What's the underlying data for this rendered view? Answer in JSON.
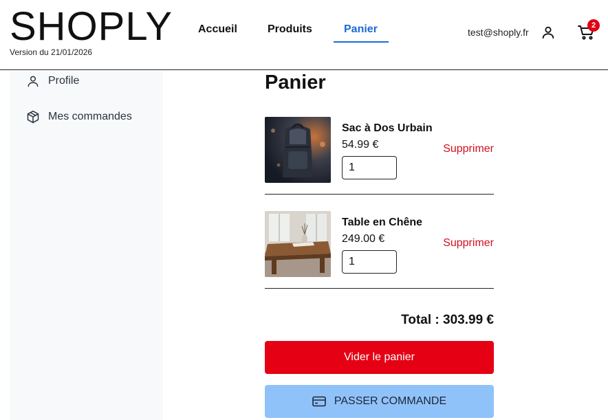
{
  "brand": {
    "logo": "SHOPLY",
    "version": "Version du 21/01/2026"
  },
  "nav": {
    "items": [
      {
        "label": "Accueil"
      },
      {
        "label": "Produits"
      },
      {
        "label": "Panier",
        "active": true
      }
    ]
  },
  "account": {
    "email": "test@shoply.fr",
    "cart_count": "2"
  },
  "sidebar": {
    "items": [
      {
        "label": "Profile",
        "icon": "user-icon"
      },
      {
        "label": "Mes commandes",
        "icon": "package-icon"
      }
    ]
  },
  "cart": {
    "title": "Panier",
    "items": [
      {
        "name": "Sac à Dos Urbain",
        "price": "54.99 €",
        "quantity": "1",
        "remove_label": "Supprimer",
        "image": "backpack-photo"
      },
      {
        "name": "Table en Chêne",
        "price": "249.00 €",
        "quantity": "1",
        "remove_label": "Supprimer",
        "image": "oak-table-photo"
      }
    ],
    "total": "Total : 303.99 €",
    "clear_label": "Vider le panier",
    "order_label": "PASSER COMMANDE"
  },
  "colors": {
    "accent": "#1a6ad6",
    "danger": "#e50014",
    "order_button": "#90c2fa",
    "sidebar_bg": "#f7f9fb"
  }
}
